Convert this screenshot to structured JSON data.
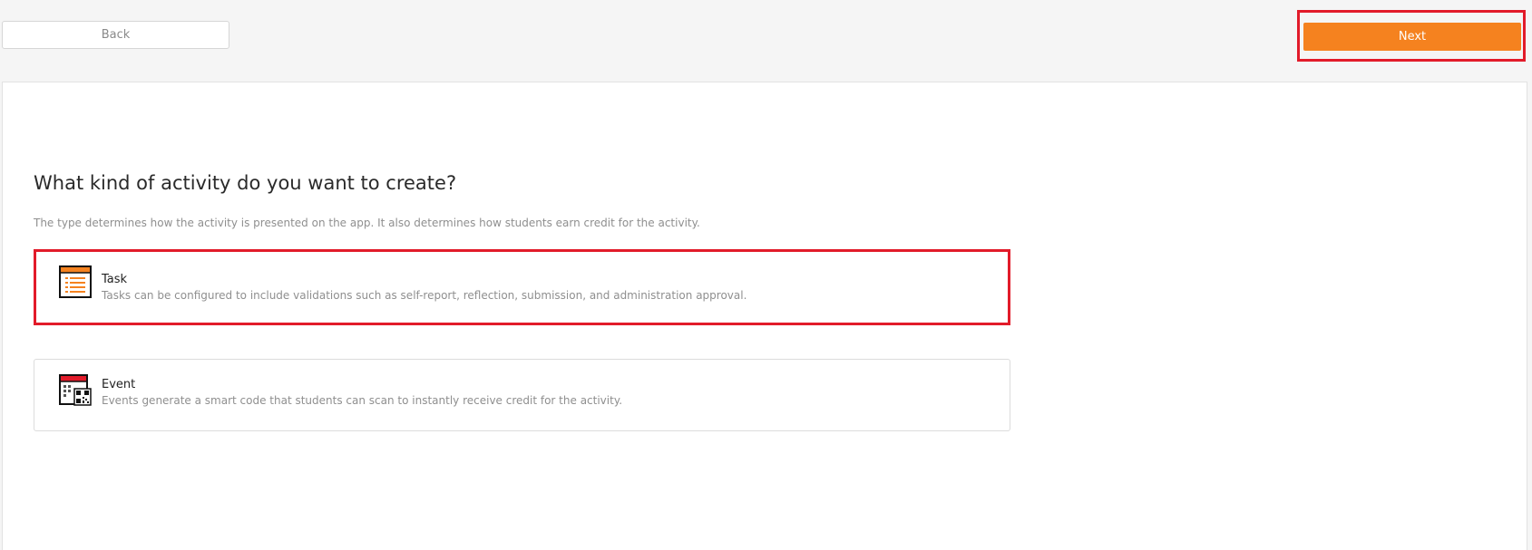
{
  "nav": {
    "back_label": "Back",
    "next_label": "Next",
    "accent_color": "#f5821f",
    "highlight_color": "#e21b2a"
  },
  "main": {
    "title": "What kind of activity do you want to create?",
    "description": "The type determines how the activity is presented on the app. It also determines how students earn credit for the activity.",
    "options": [
      {
        "title": "Task",
        "description": "Tasks can be configured to include validations such as self-report, reflection, submission, and administration approval.",
        "icon": "task-list-icon",
        "selected": true
      },
      {
        "title": "Event",
        "description": "Events generate a smart code that students can scan to instantly receive credit for the activity.",
        "icon": "event-qr-icon",
        "selected": false
      }
    ]
  }
}
